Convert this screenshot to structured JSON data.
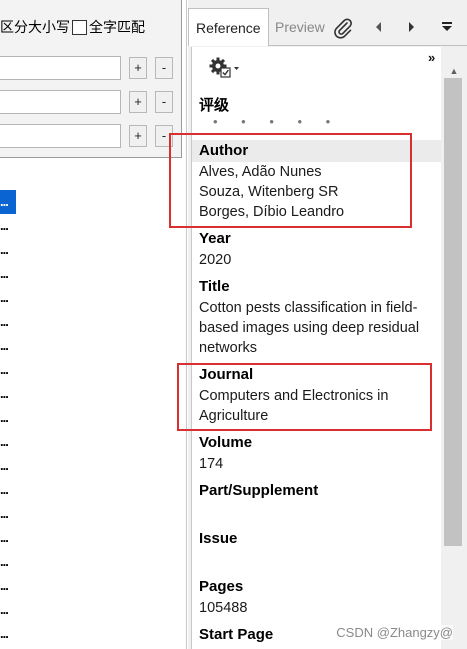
{
  "search": {
    "options_text": "区分大小写",
    "whole_word_text": "全字匹配",
    "plus_label": "+",
    "minus_label": "-"
  },
  "results": {
    "row_text": "..."
  },
  "tabs": {
    "reference": "Reference",
    "preview": "Preview"
  },
  "reference": {
    "expand": "»",
    "rating": {
      "label": "评级",
      "dots": "• • • • •"
    },
    "author": {
      "label": "Author",
      "lines": [
        "Alves, Adão Nunes",
        "Souza, Witenberg SR",
        "Borges, Díbio Leandro"
      ]
    },
    "year": {
      "label": "Year",
      "value": "2020"
    },
    "title": {
      "label": "Title",
      "value": "Cotton pests classification in field-based images using deep residual networks"
    },
    "journal": {
      "label": "Journal",
      "value": "Computers and Electronics in Agriculture"
    },
    "volume": {
      "label": "Volume",
      "value": "174"
    },
    "part": {
      "label": "Part/Supplement",
      "value": ""
    },
    "issue": {
      "label": "Issue",
      "value": ""
    },
    "pages": {
      "label": "Pages",
      "value": "105488"
    },
    "start_page": {
      "label": "Start Page"
    }
  },
  "watermark": "CSDN @Zhangzy@",
  "colors": {
    "accent": "#0a64d2",
    "highlight": "#d83030"
  }
}
